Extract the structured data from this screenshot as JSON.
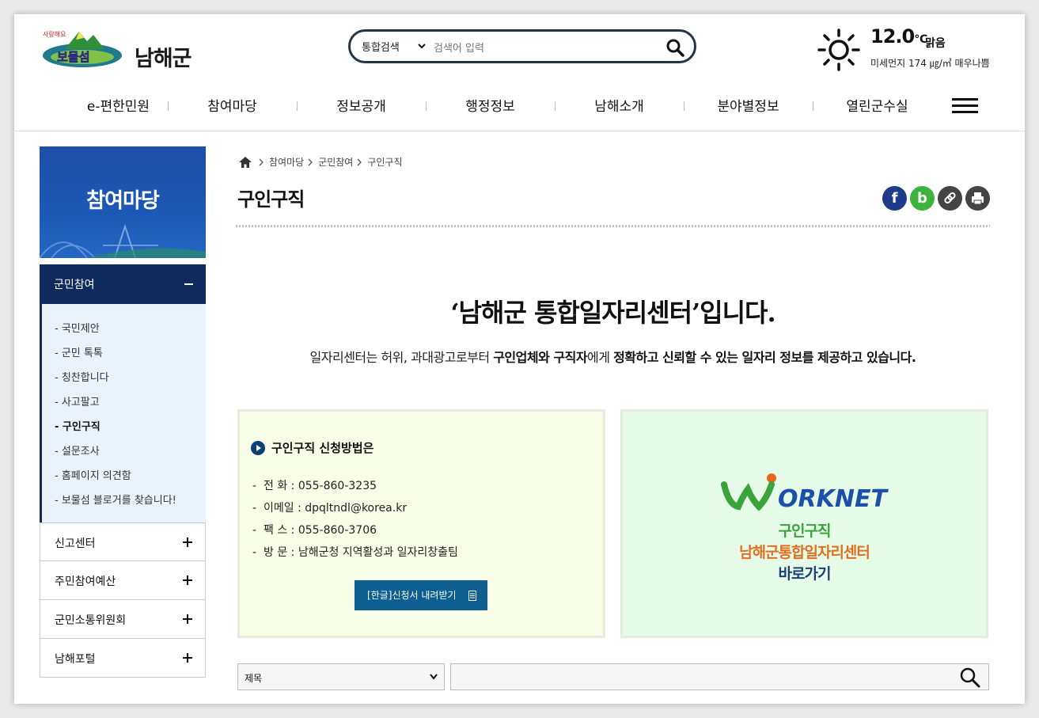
{
  "header": {
    "logo_text": "남해군",
    "search": {
      "scope": "통합검색",
      "placeholder": "검색어 입력"
    },
    "weather": {
      "temp": "12.0",
      "unit": "℃",
      "condition": "맑음",
      "dust": "미세먼지 174 ㎍/㎥ 매우나쁨"
    }
  },
  "gnb": [
    "e-편한민원",
    "참여마당",
    "정보공개",
    "행정정보",
    "남해소개",
    "분야별정보",
    "열린군수실"
  ],
  "lnb": {
    "banner_title": "참여마당",
    "active_group": "군민참여",
    "sub_items": [
      "국민제안",
      "군민 톡톡",
      "칭찬합니다",
      "사고팔고",
      "구인구직",
      "설문조사",
      "홈페이지 의견함",
      "보물섬 블로거를 찾습니다!"
    ],
    "groups": [
      "신고센터",
      "주민참여예산",
      "군민소통위원회",
      "남해포털"
    ]
  },
  "breadcrumb": [
    "참여마당",
    "군민참여",
    "구인구직"
  ],
  "page_title": "구인구직",
  "share": {
    "facebook": "f",
    "blog": "b"
  },
  "headline": "‘남해군 통합일자리센터’입니다.",
  "subline": {
    "p1": "일자리센터는 허위, 과대광고로부터 ",
    "b1": "구인업체와 구직자",
    "p2": "에게 ",
    "b2": "정확하고 신뢰할 수 있는 일자리 정보를 제공하고 있습니다."
  },
  "apply_box": {
    "heading": "구인구직 신청방법은",
    "lines": [
      "전 화 : 055-860-3235",
      "이메일 : dpqltndl@korea.kr",
      "팩 스 : 055-860-3706",
      "방 문 : 남해군청 지역활성과 일자리창출팀"
    ],
    "download_label": "[한글]신청서 내려받기"
  },
  "worknet_box": {
    "logo_text": "ORKNET",
    "line1": "구인구직",
    "line2": "남해군통합일자리센터",
    "line3": "바로가기"
  },
  "filter": {
    "field": "제목"
  },
  "colors": {
    "navy": "#0f2a5c",
    "banner_blue": "#1e4ea8",
    "download_btn": "#0d5f92",
    "worknet_green": "#3aa43b",
    "worknet_orange": "#e0701f"
  }
}
